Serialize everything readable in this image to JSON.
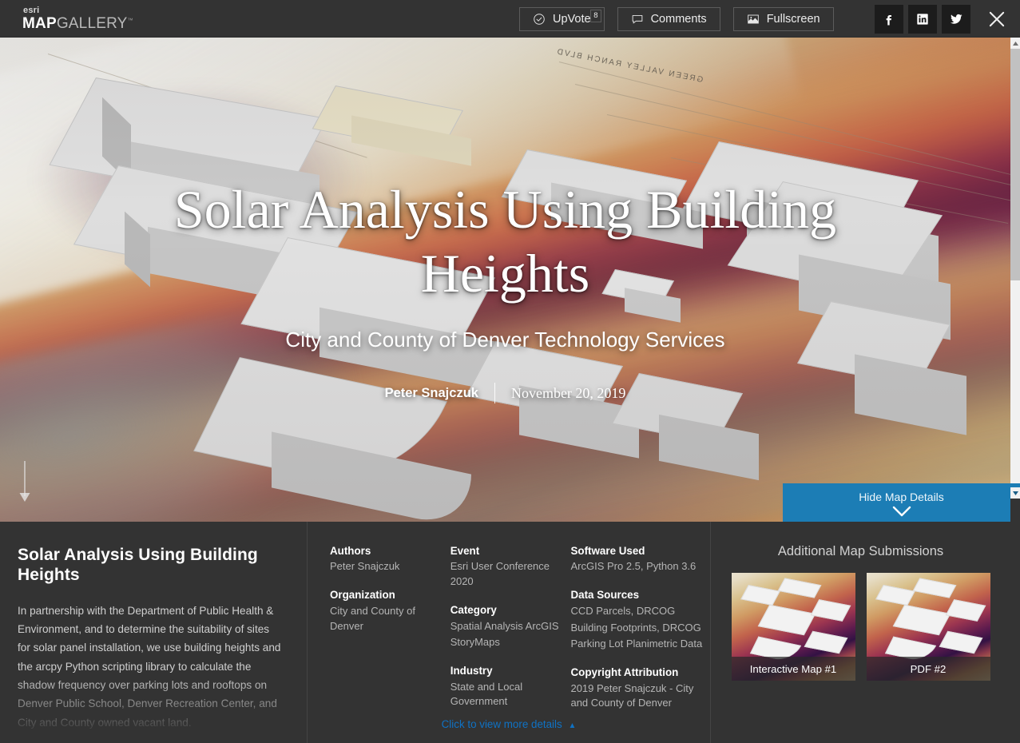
{
  "header": {
    "logo": {
      "esri": "esri",
      "map": "MAP",
      "gallery": "GALLERY",
      "tm": "™"
    },
    "buttons": [
      {
        "label": "UpVote",
        "icon": "check-circle-icon",
        "badge": "8"
      },
      {
        "label": "Comments",
        "icon": "comment-bubble-icon"
      },
      {
        "label": "Fullscreen",
        "icon": "image-icon"
      }
    ],
    "social": [
      {
        "name": "facebook-icon",
        "label": "Facebook"
      },
      {
        "name": "linkedin-icon",
        "label": "LinkedIn"
      },
      {
        "name": "twitter-icon",
        "label": "Twitter"
      }
    ],
    "close_label": "Close"
  },
  "hero": {
    "title": "Solar Analysis Using Building Heights",
    "subtitle": "City and County of Denver Technology Services",
    "author": "Peter Snajczuk",
    "date": "November 20, 2019",
    "map_street_label": "GREEN VALLEY RANCH BLVD",
    "scroll_hint": "scroll-down-arrow"
  },
  "hide_details_button": {
    "label": "Hide Map Details",
    "icon": "chevron-down-icon"
  },
  "details": {
    "title": "Solar Analysis Using Building Heights",
    "description": "In partnership with the Department of Public Health & Environment, and to determine the suitability of sites for solar panel installation, we use building heights and the arcpy Python scripting library to calculate the shadow frequency over parking lots and rooftops on Denver Public School, Denver Recreation Center, and City and County owned vacant land.",
    "meta": {
      "column1": [
        {
          "label": "Authors",
          "values": [
            "Peter Snajczuk"
          ]
        },
        {
          "label": "Organization",
          "values": [
            "City and County of Denver"
          ]
        }
      ],
      "column2": [
        {
          "label": "Event",
          "values": [
            "Esri User Conference 2020"
          ]
        },
        {
          "label": "Category",
          "values": [
            "Spatial Analysis ArcGIS",
            "StoryMaps"
          ]
        },
        {
          "label": "Industry",
          "values": [
            "State and Local Government"
          ]
        }
      ],
      "column3": [
        {
          "label": "Software Used",
          "values": [
            "ArcGIS Pro 2.5, Python 3.6"
          ]
        },
        {
          "label": "Data Sources",
          "values": [
            "CCD Parcels, DRCOG",
            "Building Footprints, DRCOG",
            "Parking Lot Planimetric Data"
          ]
        },
        {
          "label": "Copyright Attribution",
          "values": [
            "2019 Peter Snajczuk - City and County of Denver"
          ]
        }
      ]
    },
    "more_details_link": {
      "label": "Click to view more details",
      "chevron": "▲"
    },
    "additional": {
      "heading": "Additional Map Submissions",
      "items": [
        {
          "caption": "Interactive Map #1"
        },
        {
          "caption": "PDF #2"
        }
      ]
    }
  },
  "colors": {
    "chrome_dark": "#333333",
    "panel_dark": "#333333",
    "accent_blue": "#1c7db5",
    "link_blue": "#0f72c4",
    "social_tile": "#1c1c1c",
    "scrollbar_track": "#f1f1f1",
    "scrollbar_thumb": "#c1c1c1"
  }
}
